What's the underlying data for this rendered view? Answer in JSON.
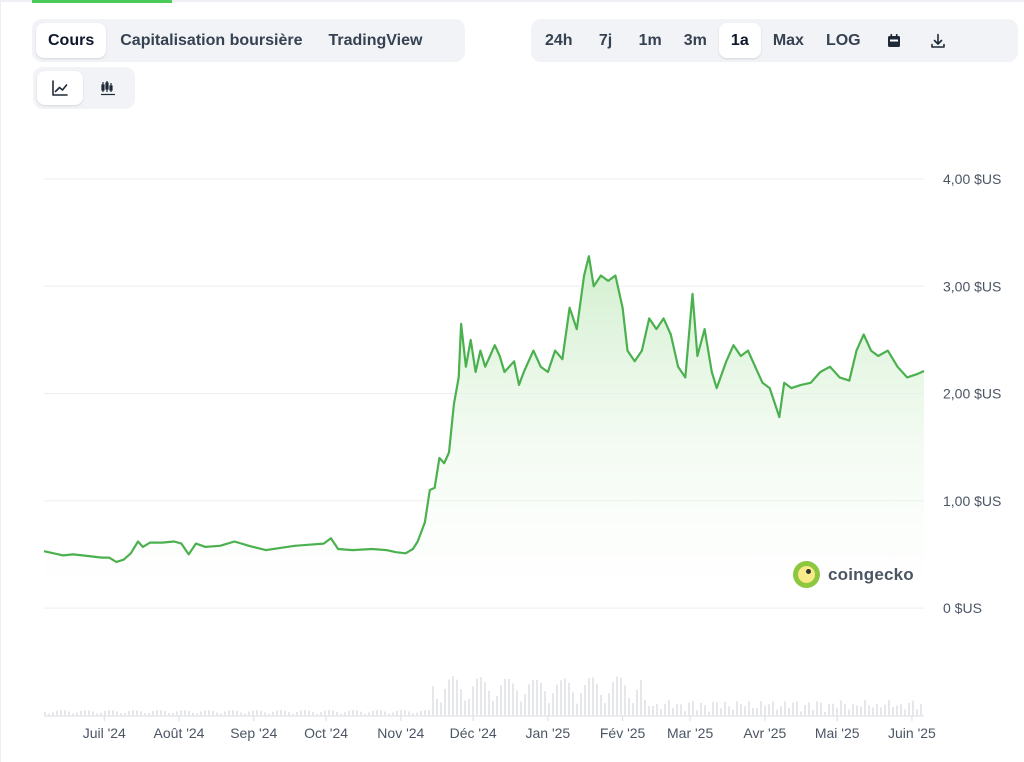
{
  "tabs": {
    "items": [
      {
        "label": "Cours",
        "active": true
      },
      {
        "label": "Capitalisation boursière",
        "active": false
      },
      {
        "label": "TradingView",
        "active": false
      }
    ]
  },
  "ranges": {
    "items": [
      {
        "label": "24h",
        "active": false
      },
      {
        "label": "7j",
        "active": false
      },
      {
        "label": "1m",
        "active": false
      },
      {
        "label": "3m",
        "active": false
      },
      {
        "label": "1a",
        "active": true
      },
      {
        "label": "Max",
        "active": false
      },
      {
        "label": "LOG",
        "active": false
      }
    ],
    "calendar_icon": "calendar-icon",
    "download_icon": "download-icon"
  },
  "chart_types": {
    "line_icon": "line-chart-icon",
    "candle_icon": "candlestick-chart-icon",
    "active": "line"
  },
  "watermark": {
    "text": "coingecko"
  },
  "colors": {
    "line": "#4bb14f",
    "fill_top": "#cfeecb",
    "fill_bottom": "#ffffff",
    "grid": "#eceef1",
    "accent": "#4bcc5a",
    "volume": "#e5e7eb"
  },
  "chart_data": {
    "type": "area",
    "title": "",
    "xlabel": "",
    "ylabel": "",
    "ylim": [
      0,
      4
    ],
    "grid": true,
    "y_ticks": [
      {
        "value": 4,
        "label": "4,00 $US"
      },
      {
        "value": 3,
        "label": "3,00 $US"
      },
      {
        "value": 2,
        "label": "2,00 $US"
      },
      {
        "value": 1,
        "label": "1,00 $US"
      },
      {
        "value": 0,
        "label": "0 $US"
      }
    ],
    "x_ticks": [
      {
        "date": "2024-07-01",
        "label": "Juil '24"
      },
      {
        "date": "2024-08-01",
        "label": "Août '24"
      },
      {
        "date": "2024-09-01",
        "label": "Sep '24"
      },
      {
        "date": "2024-10-01",
        "label": "Oct '24"
      },
      {
        "date": "2024-11-01",
        "label": "Nov '24"
      },
      {
        "date": "2024-12-01",
        "label": "Déc '24"
      },
      {
        "date": "2025-01-01",
        "label": "Jan '25"
      },
      {
        "date": "2025-02-01",
        "label": "Fév '25"
      },
      {
        "date": "2025-03-01",
        "label": "Mar '25"
      },
      {
        "date": "2025-04-01",
        "label": "Avr '25"
      },
      {
        "date": "2025-05-01",
        "label": "Mai '25"
      },
      {
        "date": "2025-06-01",
        "label": "Juin '25"
      }
    ],
    "x_range": [
      "2024-06-06",
      "2025-06-06"
    ],
    "series": [
      {
        "points": [
          [
            "2024-06-06",
            0.53
          ],
          [
            "2024-06-10",
            0.51
          ],
          [
            "2024-06-14",
            0.49
          ],
          [
            "2024-06-18",
            0.5
          ],
          [
            "2024-06-22",
            0.49
          ],
          [
            "2024-06-26",
            0.48
          ],
          [
            "2024-06-30",
            0.47
          ],
          [
            "2024-07-03",
            0.47
          ],
          [
            "2024-07-06",
            0.43
          ],
          [
            "2024-07-09",
            0.45
          ],
          [
            "2024-07-12",
            0.51
          ],
          [
            "2024-07-15",
            0.62
          ],
          [
            "2024-07-17",
            0.57
          ],
          [
            "2024-07-20",
            0.61
          ],
          [
            "2024-07-25",
            0.61
          ],
          [
            "2024-07-30",
            0.62
          ],
          [
            "2024-08-02",
            0.6
          ],
          [
            "2024-08-05",
            0.5
          ],
          [
            "2024-08-08",
            0.6
          ],
          [
            "2024-08-12",
            0.57
          ],
          [
            "2024-08-18",
            0.58
          ],
          [
            "2024-08-24",
            0.62
          ],
          [
            "2024-08-30",
            0.58
          ],
          [
            "2024-09-06",
            0.54
          ],
          [
            "2024-09-12",
            0.56
          ],
          [
            "2024-09-18",
            0.58
          ],
          [
            "2024-09-24",
            0.59
          ],
          [
            "2024-09-30",
            0.6
          ],
          [
            "2024-10-03",
            0.65
          ],
          [
            "2024-10-06",
            0.55
          ],
          [
            "2024-10-12",
            0.54
          ],
          [
            "2024-10-20",
            0.55
          ],
          [
            "2024-10-26",
            0.54
          ],
          [
            "2024-10-30",
            0.52
          ],
          [
            "2024-11-03",
            0.51
          ],
          [
            "2024-11-06",
            0.55
          ],
          [
            "2024-11-08",
            0.62
          ],
          [
            "2024-11-11",
            0.8
          ],
          [
            "2024-11-13",
            1.1
          ],
          [
            "2024-11-15",
            1.12
          ],
          [
            "2024-11-17",
            1.4
          ],
          [
            "2024-11-19",
            1.35
          ],
          [
            "2024-11-21",
            1.45
          ],
          [
            "2024-11-23",
            1.9
          ],
          [
            "2024-11-25",
            2.15
          ],
          [
            "2024-11-26",
            2.65
          ],
          [
            "2024-11-28",
            2.25
          ],
          [
            "2024-11-30",
            2.5
          ],
          [
            "2024-12-02",
            2.2
          ],
          [
            "2024-12-04",
            2.4
          ],
          [
            "2024-12-06",
            2.25
          ],
          [
            "2024-12-08",
            2.35
          ],
          [
            "2024-12-10",
            2.45
          ],
          [
            "2024-12-12",
            2.35
          ],
          [
            "2024-12-14",
            2.2
          ],
          [
            "2024-12-18",
            2.3
          ],
          [
            "2024-12-20",
            2.08
          ],
          [
            "2024-12-22",
            2.2
          ],
          [
            "2024-12-26",
            2.4
          ],
          [
            "2024-12-29",
            2.25
          ],
          [
            "2025-01-01",
            2.2
          ],
          [
            "2025-01-04",
            2.4
          ],
          [
            "2025-01-07",
            2.32
          ],
          [
            "2025-01-10",
            2.8
          ],
          [
            "2025-01-13",
            2.6
          ],
          [
            "2025-01-16",
            3.1
          ],
          [
            "2025-01-18",
            3.28
          ],
          [
            "2025-01-20",
            3.0
          ],
          [
            "2025-01-23",
            3.1
          ],
          [
            "2025-01-26",
            3.05
          ],
          [
            "2025-01-29",
            3.1
          ],
          [
            "2025-02-01",
            2.8
          ],
          [
            "2025-02-03",
            2.4
          ],
          [
            "2025-02-06",
            2.3
          ],
          [
            "2025-02-09",
            2.4
          ],
          [
            "2025-02-12",
            2.7
          ],
          [
            "2025-02-15",
            2.6
          ],
          [
            "2025-02-18",
            2.7
          ],
          [
            "2025-02-21",
            2.55
          ],
          [
            "2025-02-24",
            2.25
          ],
          [
            "2025-02-27",
            2.15
          ],
          [
            "2025-03-02",
            2.93
          ],
          [
            "2025-03-04",
            2.35
          ],
          [
            "2025-03-07",
            2.6
          ],
          [
            "2025-03-10",
            2.2
          ],
          [
            "2025-03-12",
            2.05
          ],
          [
            "2025-03-16",
            2.3
          ],
          [
            "2025-03-19",
            2.45
          ],
          [
            "2025-03-22",
            2.35
          ],
          [
            "2025-03-25",
            2.4
          ],
          [
            "2025-03-28",
            2.25
          ],
          [
            "2025-03-31",
            2.1
          ],
          [
            "2025-04-03",
            2.05
          ],
          [
            "2025-04-06",
            1.85
          ],
          [
            "2025-04-07",
            1.78
          ],
          [
            "2025-04-09",
            2.1
          ],
          [
            "2025-04-12",
            2.05
          ],
          [
            "2025-04-16",
            2.08
          ],
          [
            "2025-04-20",
            2.1
          ],
          [
            "2025-04-24",
            2.2
          ],
          [
            "2025-04-28",
            2.25
          ],
          [
            "2025-05-02",
            2.15
          ],
          [
            "2025-05-06",
            2.12
          ],
          [
            "2025-05-09",
            2.4
          ],
          [
            "2025-05-12",
            2.55
          ],
          [
            "2025-05-15",
            2.4
          ],
          [
            "2025-05-18",
            2.35
          ],
          [
            "2025-05-22",
            2.4
          ],
          [
            "2025-05-26",
            2.25
          ],
          [
            "2025-05-30",
            2.15
          ],
          [
            "2025-06-03",
            2.18
          ],
          [
            "2025-06-06",
            2.21
          ]
        ]
      }
    ]
  }
}
